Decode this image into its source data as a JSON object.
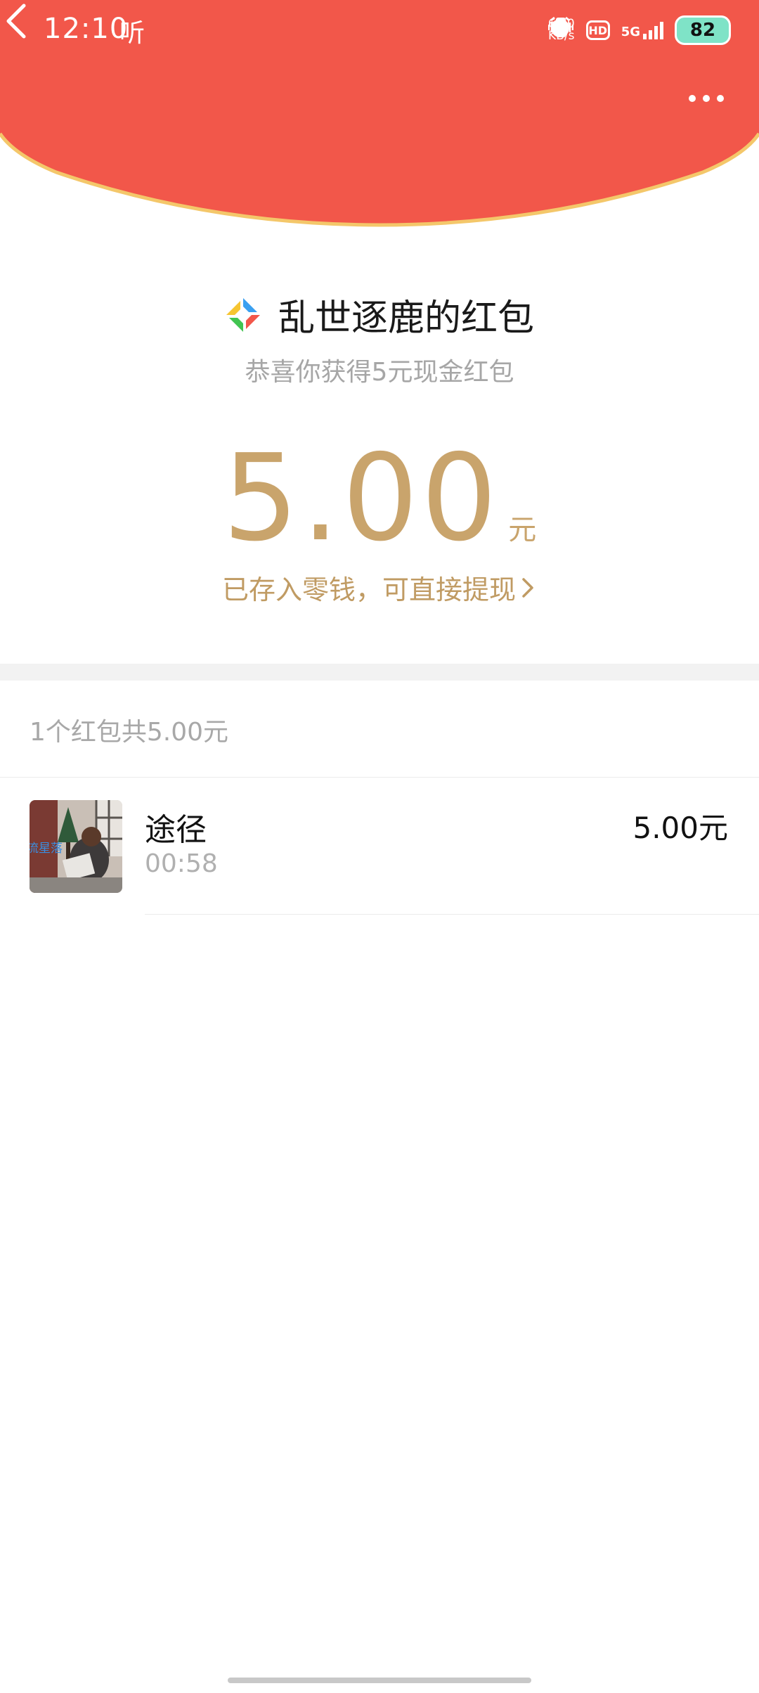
{
  "status_bar": {
    "time": "12:10",
    "listen": "听",
    "net_speed_top": "6.80",
    "net_speed_bottom": "KB/s",
    "hd": "HD",
    "network": "5G",
    "battery": "82"
  },
  "header": {
    "color": "#f2574a",
    "border_color": "#f4c76a"
  },
  "packet": {
    "sender_name": "乱世逐鹿的红包",
    "subtitle": "恭喜你获得5元现金红包",
    "amount": "5.00",
    "unit": "元",
    "stored_text": "已存入零钱，可直接提现",
    "accent_color": "#c9a46c"
  },
  "summary": {
    "text": "1个红包共5.00元"
  },
  "records": [
    {
      "name": "途径",
      "time": "00:58",
      "amount": "5.00元",
      "avatar_overlay_text": "流星落"
    }
  ]
}
